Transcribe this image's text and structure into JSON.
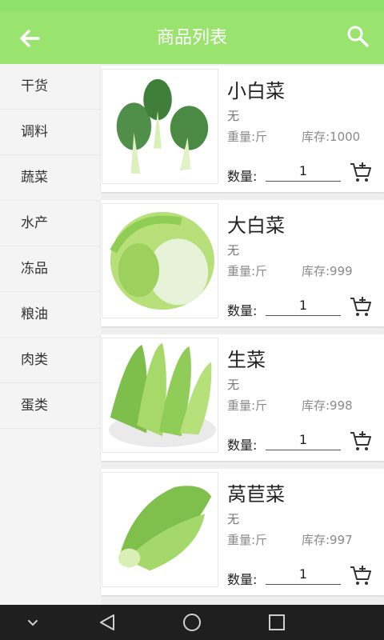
{
  "status_bar": {
    "ghost_text": ""
  },
  "header": {
    "title": "商品列表",
    "back_icon": "back-arrow-icon",
    "search_icon": "search-icon"
  },
  "sidebar": {
    "items": [
      {
        "label": "干货"
      },
      {
        "label": "调料"
      },
      {
        "label": "蔬菜"
      },
      {
        "label": "水产"
      },
      {
        "label": "冻品"
      },
      {
        "label": "粮油"
      },
      {
        "label": "肉类"
      },
      {
        "label": "蛋类"
      }
    ]
  },
  "products": [
    {
      "name": "小白菜",
      "desc": "无",
      "weight": "重量:斤",
      "stock": "库存:1000",
      "qty_label": "数量:",
      "qty": "1",
      "image": "bok-choy"
    },
    {
      "name": "大白菜",
      "desc": "无",
      "weight": "重量:斤",
      "stock": "库存:999",
      "qty_label": "数量:",
      "qty": "1",
      "image": "napa-cabbage"
    },
    {
      "name": "生菜",
      "desc": "无",
      "weight": "重量:斤",
      "stock": "库存:998",
      "qty_label": "数量:",
      "qty": "1",
      "image": "lettuce"
    },
    {
      "name": "莴苣菜",
      "desc": "无",
      "weight": "重量:斤",
      "stock": "库存:997",
      "qty_label": "数量:",
      "qty": "1",
      "image": "romaine"
    }
  ],
  "nav_bar": {
    "icons": [
      "chevron-down-icon",
      "back-triangle-icon",
      "home-circle-icon",
      "recents-square-icon"
    ]
  },
  "colors": {
    "accent": "#9be36f",
    "nav": "#1f1f1f",
    "sidebar_bg": "#f4f4f4",
    "list_bg": "#efefef"
  }
}
